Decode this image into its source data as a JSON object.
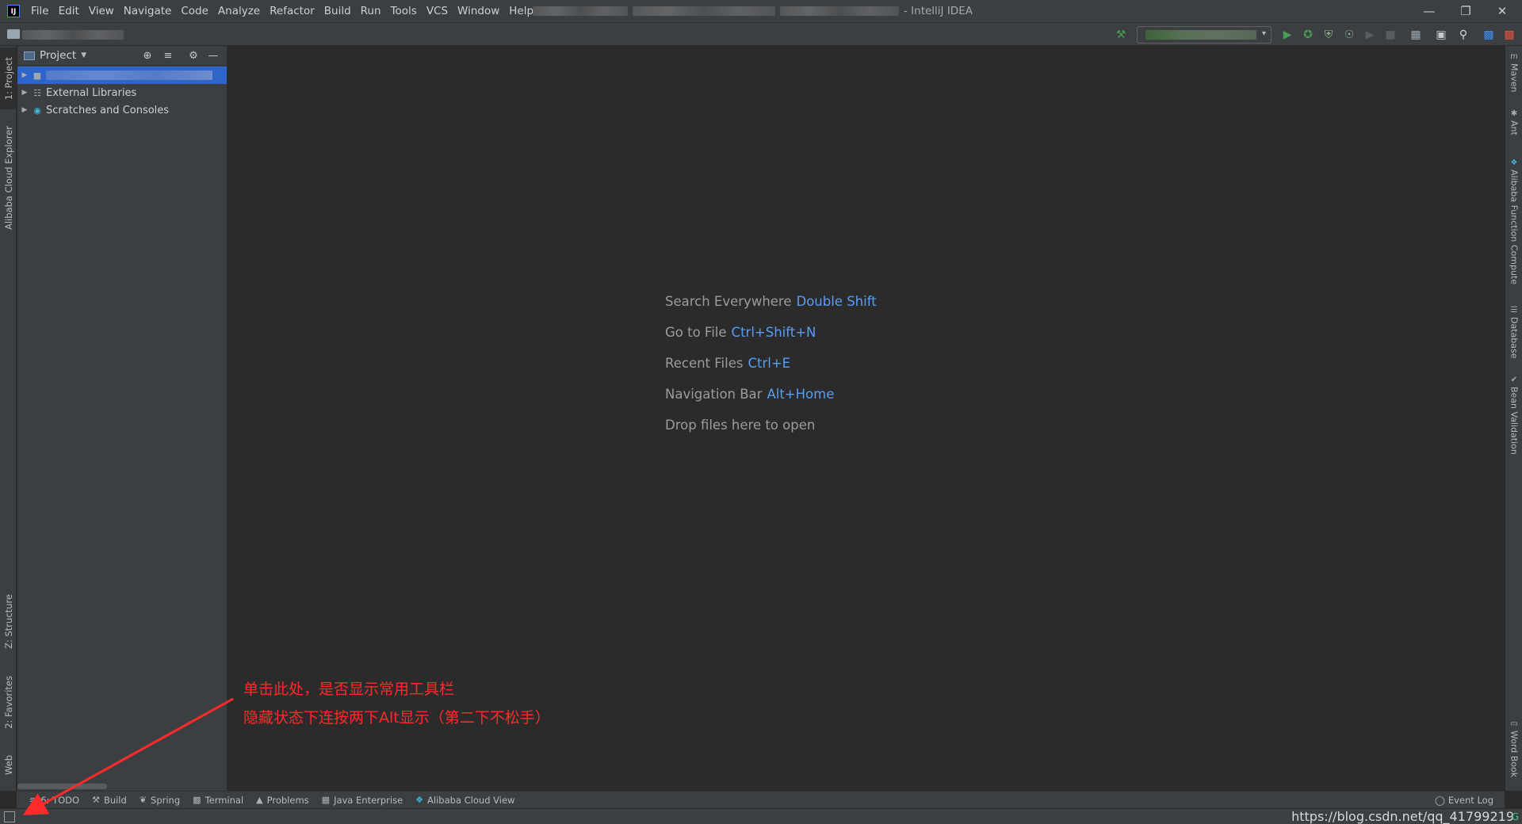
{
  "app": {
    "title_suffix": "- IntelliJ IDEA",
    "logo_text": "IJ"
  },
  "menu": [
    "File",
    "Edit",
    "View",
    "Navigate",
    "Code",
    "Analyze",
    "Refactor",
    "Build",
    "Run",
    "Tools",
    "VCS",
    "Window",
    "Help"
  ],
  "project_panel": {
    "title": "Project",
    "tree": [
      {
        "label": "",
        "icon": "project-folder-icon",
        "selected": true
      },
      {
        "label": "External Libraries",
        "icon": "libraries-icon"
      },
      {
        "label": "Scratches and Consoles",
        "icon": "scratches-icon"
      }
    ]
  },
  "left_stripe": {
    "project": "1: Project",
    "cloud_explorer": "Alibaba Cloud Explorer",
    "structure": "Z: Structure",
    "favorites": "2: Favorites",
    "web": "Web"
  },
  "right_stripe": [
    "Maven",
    "Ant",
    "Alibaba Function Compute",
    "Database",
    "Bean Validation",
    "Word Book"
  ],
  "editor_hints": [
    {
      "action": "Search Everywhere",
      "shortcut": "Double Shift"
    },
    {
      "action": "Go to File",
      "shortcut": "Ctrl+Shift+N"
    },
    {
      "action": "Recent Files",
      "shortcut": "Ctrl+E"
    },
    {
      "action": "Navigation Bar",
      "shortcut": "Alt+Home"
    },
    {
      "action": "Drop files here to open",
      "shortcut": ""
    }
  ],
  "bottom_tools": [
    {
      "label": "6: TODO",
      "icon": "todo-icon"
    },
    {
      "label": "Build",
      "icon": "build-hammer-icon"
    },
    {
      "label": "Spring",
      "icon": "spring-leaf-icon"
    },
    {
      "label": "Terminal",
      "icon": "terminal-icon"
    },
    {
      "label": "Problems",
      "icon": "warning-icon"
    },
    {
      "label": "Java Enterprise",
      "icon": "java-enterprise-icon"
    },
    {
      "label": "Alibaba Cloud View",
      "icon": "alibaba-cloud-icon"
    }
  ],
  "event_log": "Event Log",
  "annotation": {
    "line1": "单击此处，是否显示常用工具栏",
    "line2": "隐藏状态下连按两下Alt显示（第二下不松手）",
    "color": "#ff2a2a"
  },
  "watermark": "https://blog.csdn.net/qq_41799219",
  "colors": {
    "accent": "#589df6",
    "selection": "#2f65ca",
    "run_green": "#499c54"
  }
}
